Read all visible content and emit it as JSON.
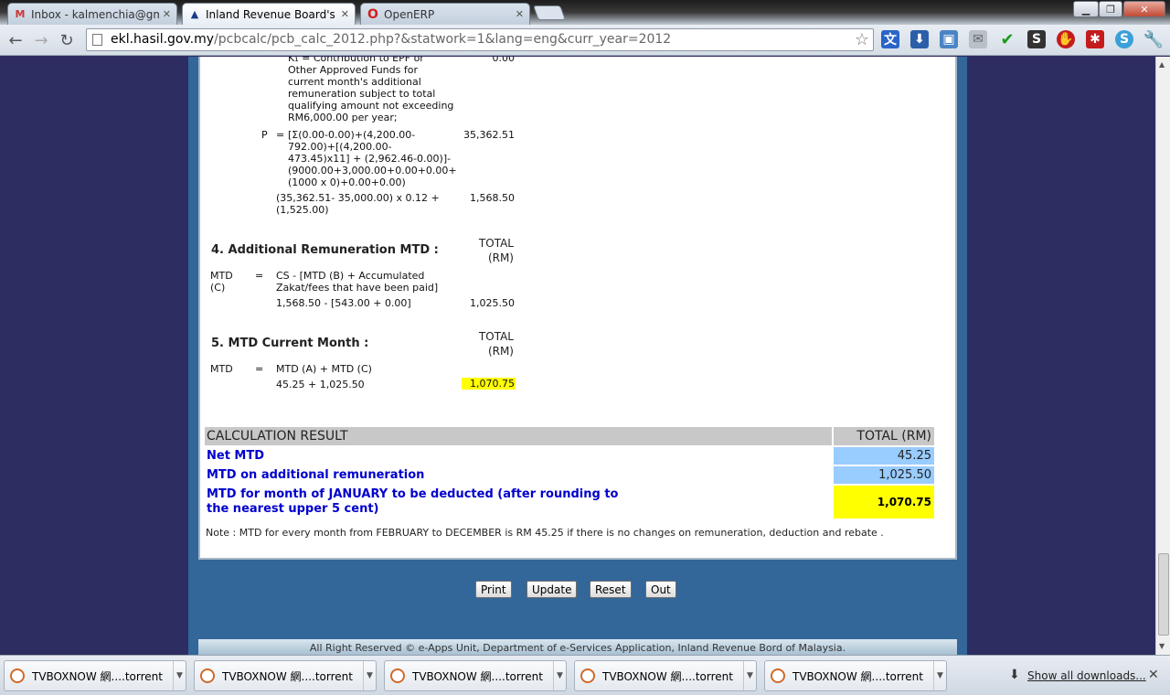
{
  "browser": {
    "tabs": [
      {
        "label": "Inbox - kalmenchia@gmai",
        "favicon": "gmail-icon",
        "active": false
      },
      {
        "label": "Inland Revenue Board's Kal",
        "favicon": "lhdn-icon",
        "active": true
      },
      {
        "label": "OpenERP",
        "favicon": "opera-icon",
        "active": false
      }
    ],
    "url_host": "ekl.hasil.gov.my",
    "url_path": "/pcbcalc/pcb_calc_2012.php?&statwork=1&lang=eng&curr_year=2012"
  },
  "calc": {
    "k1_desc": [
      "K₁ = Contribution to EPF or",
      "Other Approved Funds for",
      "current month's additional",
      "remuneration subject to total",
      "qualifying amount not exceeding",
      "RM6,000.00 per year;"
    ],
    "k1_value": "0.00",
    "p_label": "P",
    "eq": "=",
    "p_formula": [
      "[Σ(0.00-0.00)+(4,200.00-",
      "792.00)+[(4,200.00-",
      "473.45)x11] + (2,962.46-0.00)]-",
      "(9000.00+3,000.00+0.00+0.00+",
      "(1000 x 0)+0.00+0.00)"
    ],
    "p_value": "35,362.51",
    "tax_formula": [
      "(35,362.51- 35,000.00) x 0.12 +",
      "(1,525.00)"
    ],
    "tax_value": "1,568.50",
    "sec4_title": "4. Additional Remuneration MTD :",
    "total_rm": [
      "TOTAL",
      "(RM)"
    ],
    "sec4_label": [
      "MTD",
      "(C)"
    ],
    "sec4_formula": [
      "CS - [MTD (B) + Accumulated",
      "Zakat/fees that have been paid]"
    ],
    "sec4_calc": "1,568.50 - [543.00 + 0.00]",
    "sec4_value": "1,025.50",
    "sec5_title": "5. MTD Current Month :",
    "sec5_label": "MTD",
    "sec5_formula": "MTD (A) + MTD (C)",
    "sec5_calc": "45.25 + 1,025.50",
    "sec5_value": "1,070.75"
  },
  "result": {
    "header_left": "CALCULATION RESULT",
    "header_right": "TOTAL (RM)",
    "rows": [
      {
        "label": "Net MTD",
        "value": "45.25"
      },
      {
        "label": "MTD on additional remuneration",
        "value": "1,025.50"
      },
      {
        "label": "MTD for month of JANUARY to be deducted (after rounding to the nearest upper 5 cent)",
        "value": "1,070.75"
      }
    ],
    "note": "Note : MTD for every month from FEBRUARY to DECEMBER is RM 45.25 if there is no changes on remuneration, deduction and rebate ."
  },
  "buttons": {
    "print": "Print",
    "update": "Update",
    "reset": "Reset",
    "out": "Out"
  },
  "footer": "All Right Reserved © e-Apps Unit, Department of e-Services Application, Inland Revenue Bord of Malaysia.",
  "downloads": {
    "items": [
      "TVBOXNOW 網....torrent",
      "TVBOXNOW 網....torrent",
      "TVBOXNOW 網....torrent",
      "TVBOXNOW 網....torrent",
      "TVBOXNOW 網....torrent"
    ],
    "show_all": "Show all downloads..."
  }
}
